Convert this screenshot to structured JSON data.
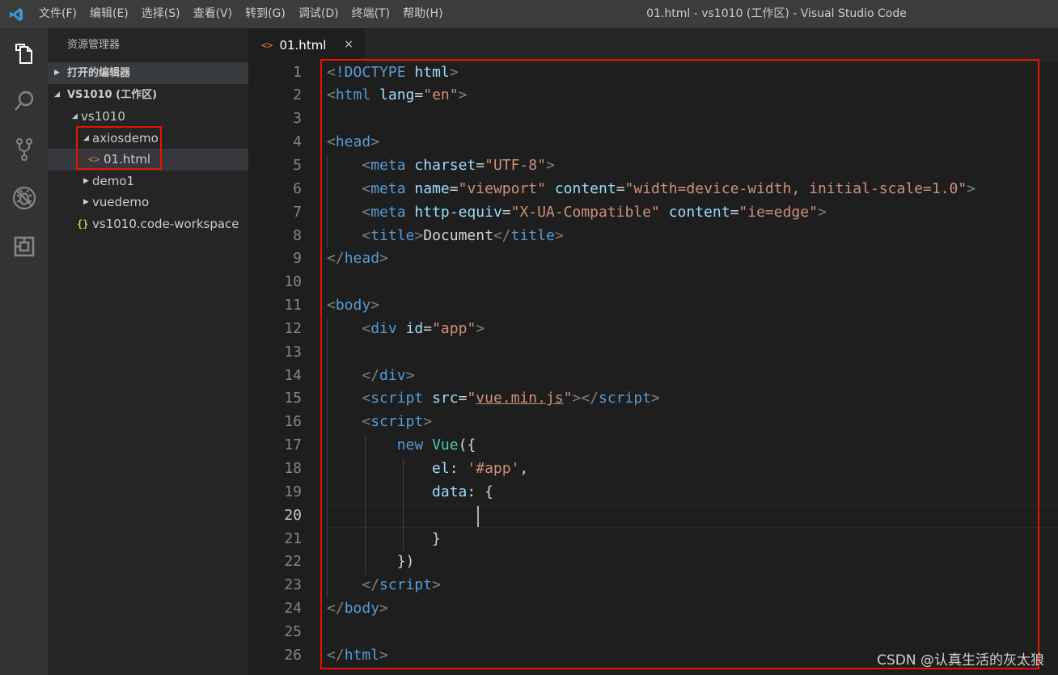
{
  "window": {
    "title": "01.html - vs1010 (工作区) - Visual Studio Code"
  },
  "menu": [
    "文件(F)",
    "编辑(E)",
    "选择(S)",
    "查看(V)",
    "转到(G)",
    "调试(D)",
    "终端(T)",
    "帮助(H)"
  ],
  "activity_bar": [
    "explorer-icon",
    "search-icon",
    "source-control-icon",
    "debug-icon",
    "extensions-icon"
  ],
  "sidebar": {
    "title": "资源管理器",
    "open_editors_label": "打开的编辑器",
    "workspace_label": "VS1010 (工作区)",
    "tree": [
      {
        "label": "vs1010",
        "kind": "folder",
        "expanded": true,
        "depth": 0
      },
      {
        "label": "axiosdemo",
        "kind": "folder",
        "expanded": true,
        "depth": 1
      },
      {
        "label": "01.html",
        "kind": "html",
        "depth": 2,
        "selected": true
      },
      {
        "label": "demo1",
        "kind": "folder",
        "expanded": false,
        "depth": 1
      },
      {
        "label": "vuedemo",
        "kind": "folder",
        "expanded": false,
        "depth": 1
      },
      {
        "label": "vs1010.code-workspace",
        "kind": "json",
        "depth": 1
      }
    ]
  },
  "tab": {
    "label": "01.html",
    "icon": "html-file-icon",
    "close": "×"
  },
  "editor": {
    "active_line": 20,
    "lines": [
      [
        [
          "p",
          "<"
        ],
        [
          "t",
          "!DOCTYPE"
        ],
        [
          "x",
          " "
        ],
        [
          "a",
          "html"
        ],
        [
          "p",
          ">"
        ]
      ],
      [
        [
          "p",
          "<"
        ],
        [
          "t",
          "html"
        ],
        [
          "x",
          " "
        ],
        [
          "a",
          "lang"
        ],
        [
          "x",
          "="
        ],
        [
          "s",
          "\"en\""
        ],
        [
          "p",
          ">"
        ]
      ],
      [],
      [
        [
          "p",
          "<"
        ],
        [
          "t",
          "head"
        ],
        [
          "p",
          ">"
        ]
      ],
      [
        [
          "x",
          "    "
        ],
        [
          "p",
          "<"
        ],
        [
          "t",
          "meta"
        ],
        [
          "x",
          " "
        ],
        [
          "a",
          "charset"
        ],
        [
          "x",
          "="
        ],
        [
          "s",
          "\"UTF-8\""
        ],
        [
          "p",
          ">"
        ]
      ],
      [
        [
          "x",
          "    "
        ],
        [
          "p",
          "<"
        ],
        [
          "t",
          "meta"
        ],
        [
          "x",
          " "
        ],
        [
          "a",
          "name"
        ],
        [
          "x",
          "="
        ],
        [
          "s",
          "\"viewport\""
        ],
        [
          "x",
          " "
        ],
        [
          "a",
          "content"
        ],
        [
          "x",
          "="
        ],
        [
          "s",
          "\"width=device-width, initial-scale=1.0\""
        ],
        [
          "p",
          ">"
        ]
      ],
      [
        [
          "x",
          "    "
        ],
        [
          "p",
          "<"
        ],
        [
          "t",
          "meta"
        ],
        [
          "x",
          " "
        ],
        [
          "a",
          "http-equiv"
        ],
        [
          "x",
          "="
        ],
        [
          "s",
          "\"X-UA-Compatible\""
        ],
        [
          "x",
          " "
        ],
        [
          "a",
          "content"
        ],
        [
          "x",
          "="
        ],
        [
          "s",
          "\"ie=edge\""
        ],
        [
          "p",
          ">"
        ]
      ],
      [
        [
          "x",
          "    "
        ],
        [
          "p",
          "<"
        ],
        [
          "t",
          "title"
        ],
        [
          "p",
          ">"
        ],
        [
          "x",
          "Document"
        ],
        [
          "p",
          "</"
        ],
        [
          "t",
          "title"
        ],
        [
          "p",
          ">"
        ]
      ],
      [
        [
          "p",
          "</"
        ],
        [
          "t",
          "head"
        ],
        [
          "p",
          ">"
        ]
      ],
      [],
      [
        [
          "p",
          "<"
        ],
        [
          "t",
          "body"
        ],
        [
          "p",
          ">"
        ]
      ],
      [
        [
          "x",
          "    "
        ],
        [
          "p",
          "<"
        ],
        [
          "t",
          "div"
        ],
        [
          "x",
          " "
        ],
        [
          "a",
          "id"
        ],
        [
          "x",
          "="
        ],
        [
          "s",
          "\"app\""
        ],
        [
          "p",
          ">"
        ]
      ],
      [],
      [
        [
          "x",
          "    "
        ],
        [
          "p",
          "</"
        ],
        [
          "t",
          "div"
        ],
        [
          "p",
          ">"
        ]
      ],
      [
        [
          "x",
          "    "
        ],
        [
          "p",
          "<"
        ],
        [
          "t",
          "script"
        ],
        [
          "x",
          " "
        ],
        [
          "a",
          "src"
        ],
        [
          "x",
          "="
        ],
        [
          "s",
          "\""
        ],
        [
          "u",
          "vue.min.js"
        ],
        [
          "s",
          "\""
        ],
        [
          "p",
          "></"
        ],
        [
          "t",
          "script"
        ],
        [
          "p",
          ">"
        ]
      ],
      [
        [
          "x",
          "    "
        ],
        [
          "p",
          "<"
        ],
        [
          "t",
          "script"
        ],
        [
          "p",
          ">"
        ]
      ],
      [
        [
          "x",
          "        "
        ],
        [
          "t",
          "new"
        ],
        [
          "x",
          " "
        ],
        [
          "c",
          "Vue"
        ],
        [
          "x",
          "({"
        ]
      ],
      [
        [
          "x",
          "            "
        ],
        [
          "a",
          "el"
        ],
        [
          "x",
          ": "
        ],
        [
          "s",
          "'#app'"
        ],
        [
          "x",
          ","
        ]
      ],
      [
        [
          "x",
          "            "
        ],
        [
          "a",
          "data"
        ],
        [
          "x",
          ": {"
        ]
      ],
      [],
      [
        [
          "x",
          "            }"
        ]
      ],
      [
        [
          "x",
          "        })"
        ]
      ],
      [
        [
          "x",
          "    "
        ],
        [
          "p",
          "</"
        ],
        [
          "t",
          "script"
        ],
        [
          "p",
          ">"
        ]
      ],
      [
        [
          "p",
          "</"
        ],
        [
          "t",
          "body"
        ],
        [
          "p",
          ">"
        ]
      ],
      [],
      [
        [
          "p",
          "</"
        ],
        [
          "t",
          "html"
        ],
        [
          "p",
          ">"
        ]
      ]
    ]
  },
  "watermark": "CSDN @认真生活的灰太狼",
  "colors": {
    "tag": "#569cd6",
    "attribute": "#9cdcfe",
    "string": "#ce9178",
    "punctuation": "#808080",
    "text": "#d4d4d4",
    "class": "#4ec9b0",
    "highlight_box": "#e51400"
  }
}
